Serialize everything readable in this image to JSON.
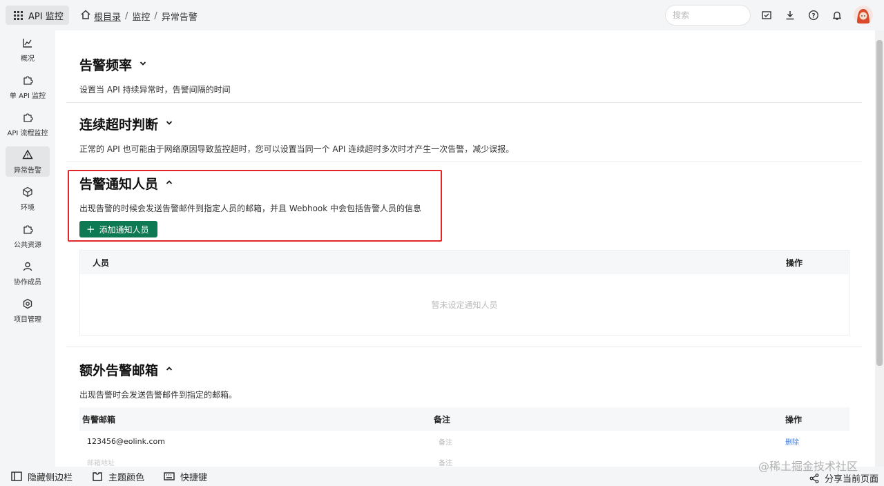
{
  "app": {
    "name": "API 监控"
  },
  "breadcrumb": {
    "root": "根目录",
    "sep": "/",
    "monitor": "监控",
    "current": "异常告警"
  },
  "search": {
    "placeholder": "搜索"
  },
  "sidebar": {
    "items": [
      {
        "label": "概况",
        "icon": "chart-icon"
      },
      {
        "label": "单 API 监控",
        "icon": "puzzle-icon"
      },
      {
        "label": "API 流程监控",
        "icon": "puzzle-icon"
      },
      {
        "label": "异常告警",
        "icon": "warning-icon",
        "active": true
      },
      {
        "label": "环境",
        "icon": "cube-icon"
      },
      {
        "label": "公共资源",
        "icon": "puzzle-icon"
      },
      {
        "label": "协作成员",
        "icon": "user-icon"
      },
      {
        "label": "项目管理",
        "icon": "gear-icon"
      }
    ]
  },
  "sections": {
    "frequency": {
      "title": "告警频率",
      "desc": "设置当 API 持续异常时，告警间隔的时间"
    },
    "timeout": {
      "title": "连续超时判断",
      "desc": "正常的 API 也可能由于网络原因导致监控超时，您可以设置当同一个 API 连续超时多次时才产生一次告警，减少误报。"
    },
    "notify": {
      "title": "告警通知人员",
      "desc": "出现告警的时候会发送告警邮件到指定人员的邮箱，并且 Webhook 中会包括告警人员的信息",
      "add_label": "添加通知人员",
      "table": {
        "col_person": "人员",
        "col_action": "操作",
        "empty": "暂未设定通知人员"
      }
    },
    "extra": {
      "title": "额外告警邮箱",
      "desc": "出现告警时会发送告警邮件到指定的邮箱。",
      "table": {
        "col_email": "告警邮箱",
        "col_note": "备注",
        "col_action": "操作",
        "rows": [
          {
            "email": "123456@eolink.com",
            "note": "备注",
            "action": "删除"
          },
          {
            "email": "邮箱地址",
            "note": "备注",
            "action": ""
          }
        ]
      }
    }
  },
  "bottombar": {
    "hide_sidebar": "隐藏侧边栏",
    "theme": "主题颜色",
    "shortcuts": "快捷键",
    "share": "分享当前页面",
    "watermark": "@稀土掘金技术社区"
  },
  "colors": {
    "accent": "#0d7a53",
    "highlight": "#e3262a",
    "link": "#3a7be0"
  }
}
